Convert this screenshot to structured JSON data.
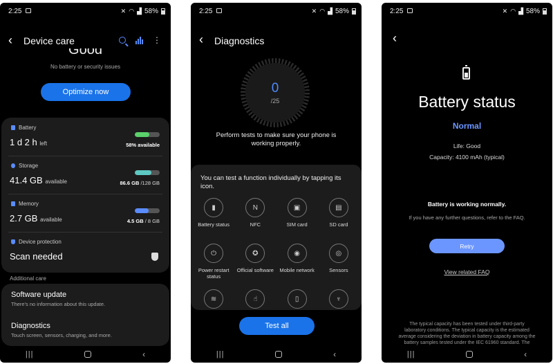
{
  "status_bar": {
    "time": "2:25",
    "battery": "58%"
  },
  "device_care": {
    "title": "Device care",
    "score_partial": "Good",
    "no_issues": "No battery or security issues",
    "optimize_label": "Optimize now",
    "battery": {
      "label": "Battery",
      "value": "1 d 2 h",
      "unit": "left",
      "status": "58% available",
      "level": 0.58,
      "color": "#5ad16b"
    },
    "storage": {
      "label": "Storage",
      "value": "41.4 GB",
      "unit": "available",
      "used": "86.6 GB",
      "total": "/128 GB",
      "level": 0.68,
      "color": "#5ec9c3"
    },
    "memory": {
      "label": "Memory",
      "value": "2.7 GB",
      "unit": "available",
      "used": "4.5 GB",
      "total": "/ 8 GB",
      "level": 0.56,
      "color": "#5a8cff"
    },
    "protection": {
      "label": "Device protection",
      "value": "Scan needed"
    },
    "additional_label": "Additional care",
    "software_update": {
      "title": "Software update",
      "subtitle": "There's no information about this update."
    },
    "diagnostics": {
      "title": "Diagnostics",
      "subtitle": "Touch screen, sensors, charging, and more."
    }
  },
  "diagnostics": {
    "title": "Diagnostics",
    "count": "0",
    "total": "/25",
    "description": "Perform tests to make sure your phone is working properly.",
    "card_heading": "You can test a function individually by tapping its icon.",
    "tests": [
      {
        "label": "Battery status",
        "icon": "battery-icon"
      },
      {
        "label": "NFC",
        "icon": "nfc-icon"
      },
      {
        "label": "SIM card",
        "icon": "sim-icon"
      },
      {
        "label": "SD card",
        "icon": "sd-card-icon"
      },
      {
        "label": "Power restart status",
        "icon": "power-icon"
      },
      {
        "label": "Official software",
        "icon": "badge-icon"
      },
      {
        "label": "Mobile network",
        "icon": "antenna-icon"
      },
      {
        "label": "Sensors",
        "icon": "sensor-icon"
      },
      {
        "label": "",
        "icon": "vibration-icon"
      },
      {
        "label": "",
        "icon": "touch-icon"
      },
      {
        "label": "",
        "icon": "phone-icon"
      },
      {
        "label": "",
        "icon": "flashlight-icon"
      }
    ],
    "test_all_label": "Test all"
  },
  "battery_status": {
    "title": "Battery status",
    "status": "Normal",
    "life": "Life: Good",
    "capacity": "Capacity: 4100 mAh (typical)",
    "working": "Battery is working normally.",
    "faq_hint": "If you have any further questions, refer to the FAQ.",
    "retry_label": "Retry",
    "faq_link": "View related FAQ",
    "footnote": "The typical capacity has been tested under third-party laboratory conditions. The typical capacity is the estimated average considering the deviation in battery capacity among the battery samples tested under the IEC 61960 standard. The"
  }
}
